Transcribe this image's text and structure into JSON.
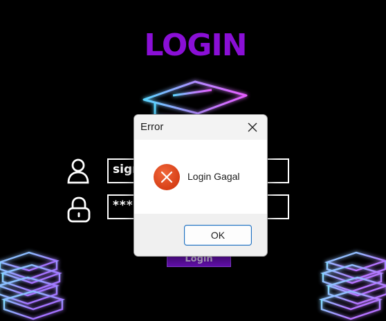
{
  "window": {
    "title": "LOGIN"
  },
  "form": {
    "username_value": "sign",
    "password_value": "****",
    "login_label": "Login"
  },
  "icons": {
    "cap": "graduation-cap-icon",
    "user": "user-icon",
    "lock": "lock-icon",
    "books": "books-icon",
    "error": "error-icon",
    "close": "close-icon"
  },
  "dialog": {
    "title": "Error",
    "message": "Login Gagal",
    "ok_label": "OK"
  },
  "colors": {
    "title": "#8a0fd6",
    "login_button": "#6a10b8",
    "error_icon": "#e04a1c",
    "ok_border": "#1e6fbf"
  }
}
